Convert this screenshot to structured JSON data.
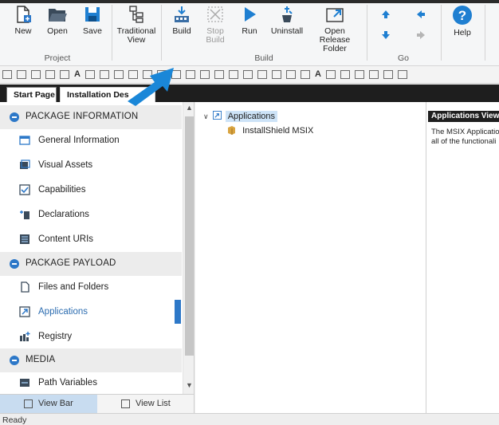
{
  "ribbon": {
    "buttons": [
      {
        "label": "New",
        "icon": "new-file-icon"
      },
      {
        "label": "Open",
        "icon": "folder-open-icon"
      },
      {
        "label": "Save",
        "icon": "save-disk-icon"
      },
      {
        "label": "Traditional View",
        "icon": "tree-view-icon"
      },
      {
        "label": "Build",
        "icon": "build-icon"
      },
      {
        "label": "Stop Build",
        "icon": "stop-build-icon"
      },
      {
        "label": "Run",
        "icon": "run-play-icon"
      },
      {
        "label": "Uninstall",
        "icon": "uninstall-icon"
      },
      {
        "label": "Open Release Folder",
        "icon": "release-folder-icon"
      },
      {
        "label": "Help",
        "icon": "help-icon"
      }
    ],
    "groups": [
      "Project",
      "Build",
      "Go"
    ],
    "nav_icons": [
      "arrow-up-icon",
      "arrow-left-icon",
      "arrow-down-icon",
      "arrow-right-icon"
    ]
  },
  "tabs": [
    "Start Page",
    "Installation Des"
  ],
  "sidebar": {
    "sections": [
      {
        "label": "PACKAGE INFORMATION"
      },
      {
        "label": "PACKAGE PAYLOAD"
      },
      {
        "label": "MEDIA"
      }
    ],
    "items": [
      {
        "label": "General Information",
        "icon": "window-icon"
      },
      {
        "label": "Visual Assets",
        "icon": "images-icon"
      },
      {
        "label": "Capabilities",
        "icon": "checkbox-icon"
      },
      {
        "label": "Declarations",
        "icon": "declarations-icon"
      },
      {
        "label": "Content URIs",
        "icon": "content-uri-icon"
      },
      {
        "label": "Files and Folders",
        "icon": "file-icon"
      },
      {
        "label": "Applications",
        "icon": "application-icon"
      },
      {
        "label": "Registry",
        "icon": "registry-icon"
      },
      {
        "label": "Path Variables",
        "icon": "path-variables-icon"
      }
    ],
    "active_item": "Applications"
  },
  "viewbar": {
    "view_bar": "View Bar",
    "view_list": "View List"
  },
  "tree": {
    "root": "Applications",
    "child": "InstallShield MSIX"
  },
  "right_panel": {
    "header": "Applications View",
    "line1": "The MSIX Applicatio",
    "line2": "all of the functionali"
  },
  "status": {
    "text": "Ready"
  },
  "colors": {
    "accent": "#2d78c8",
    "arrow": "#1a87d8",
    "selection": "#cde3f7"
  }
}
